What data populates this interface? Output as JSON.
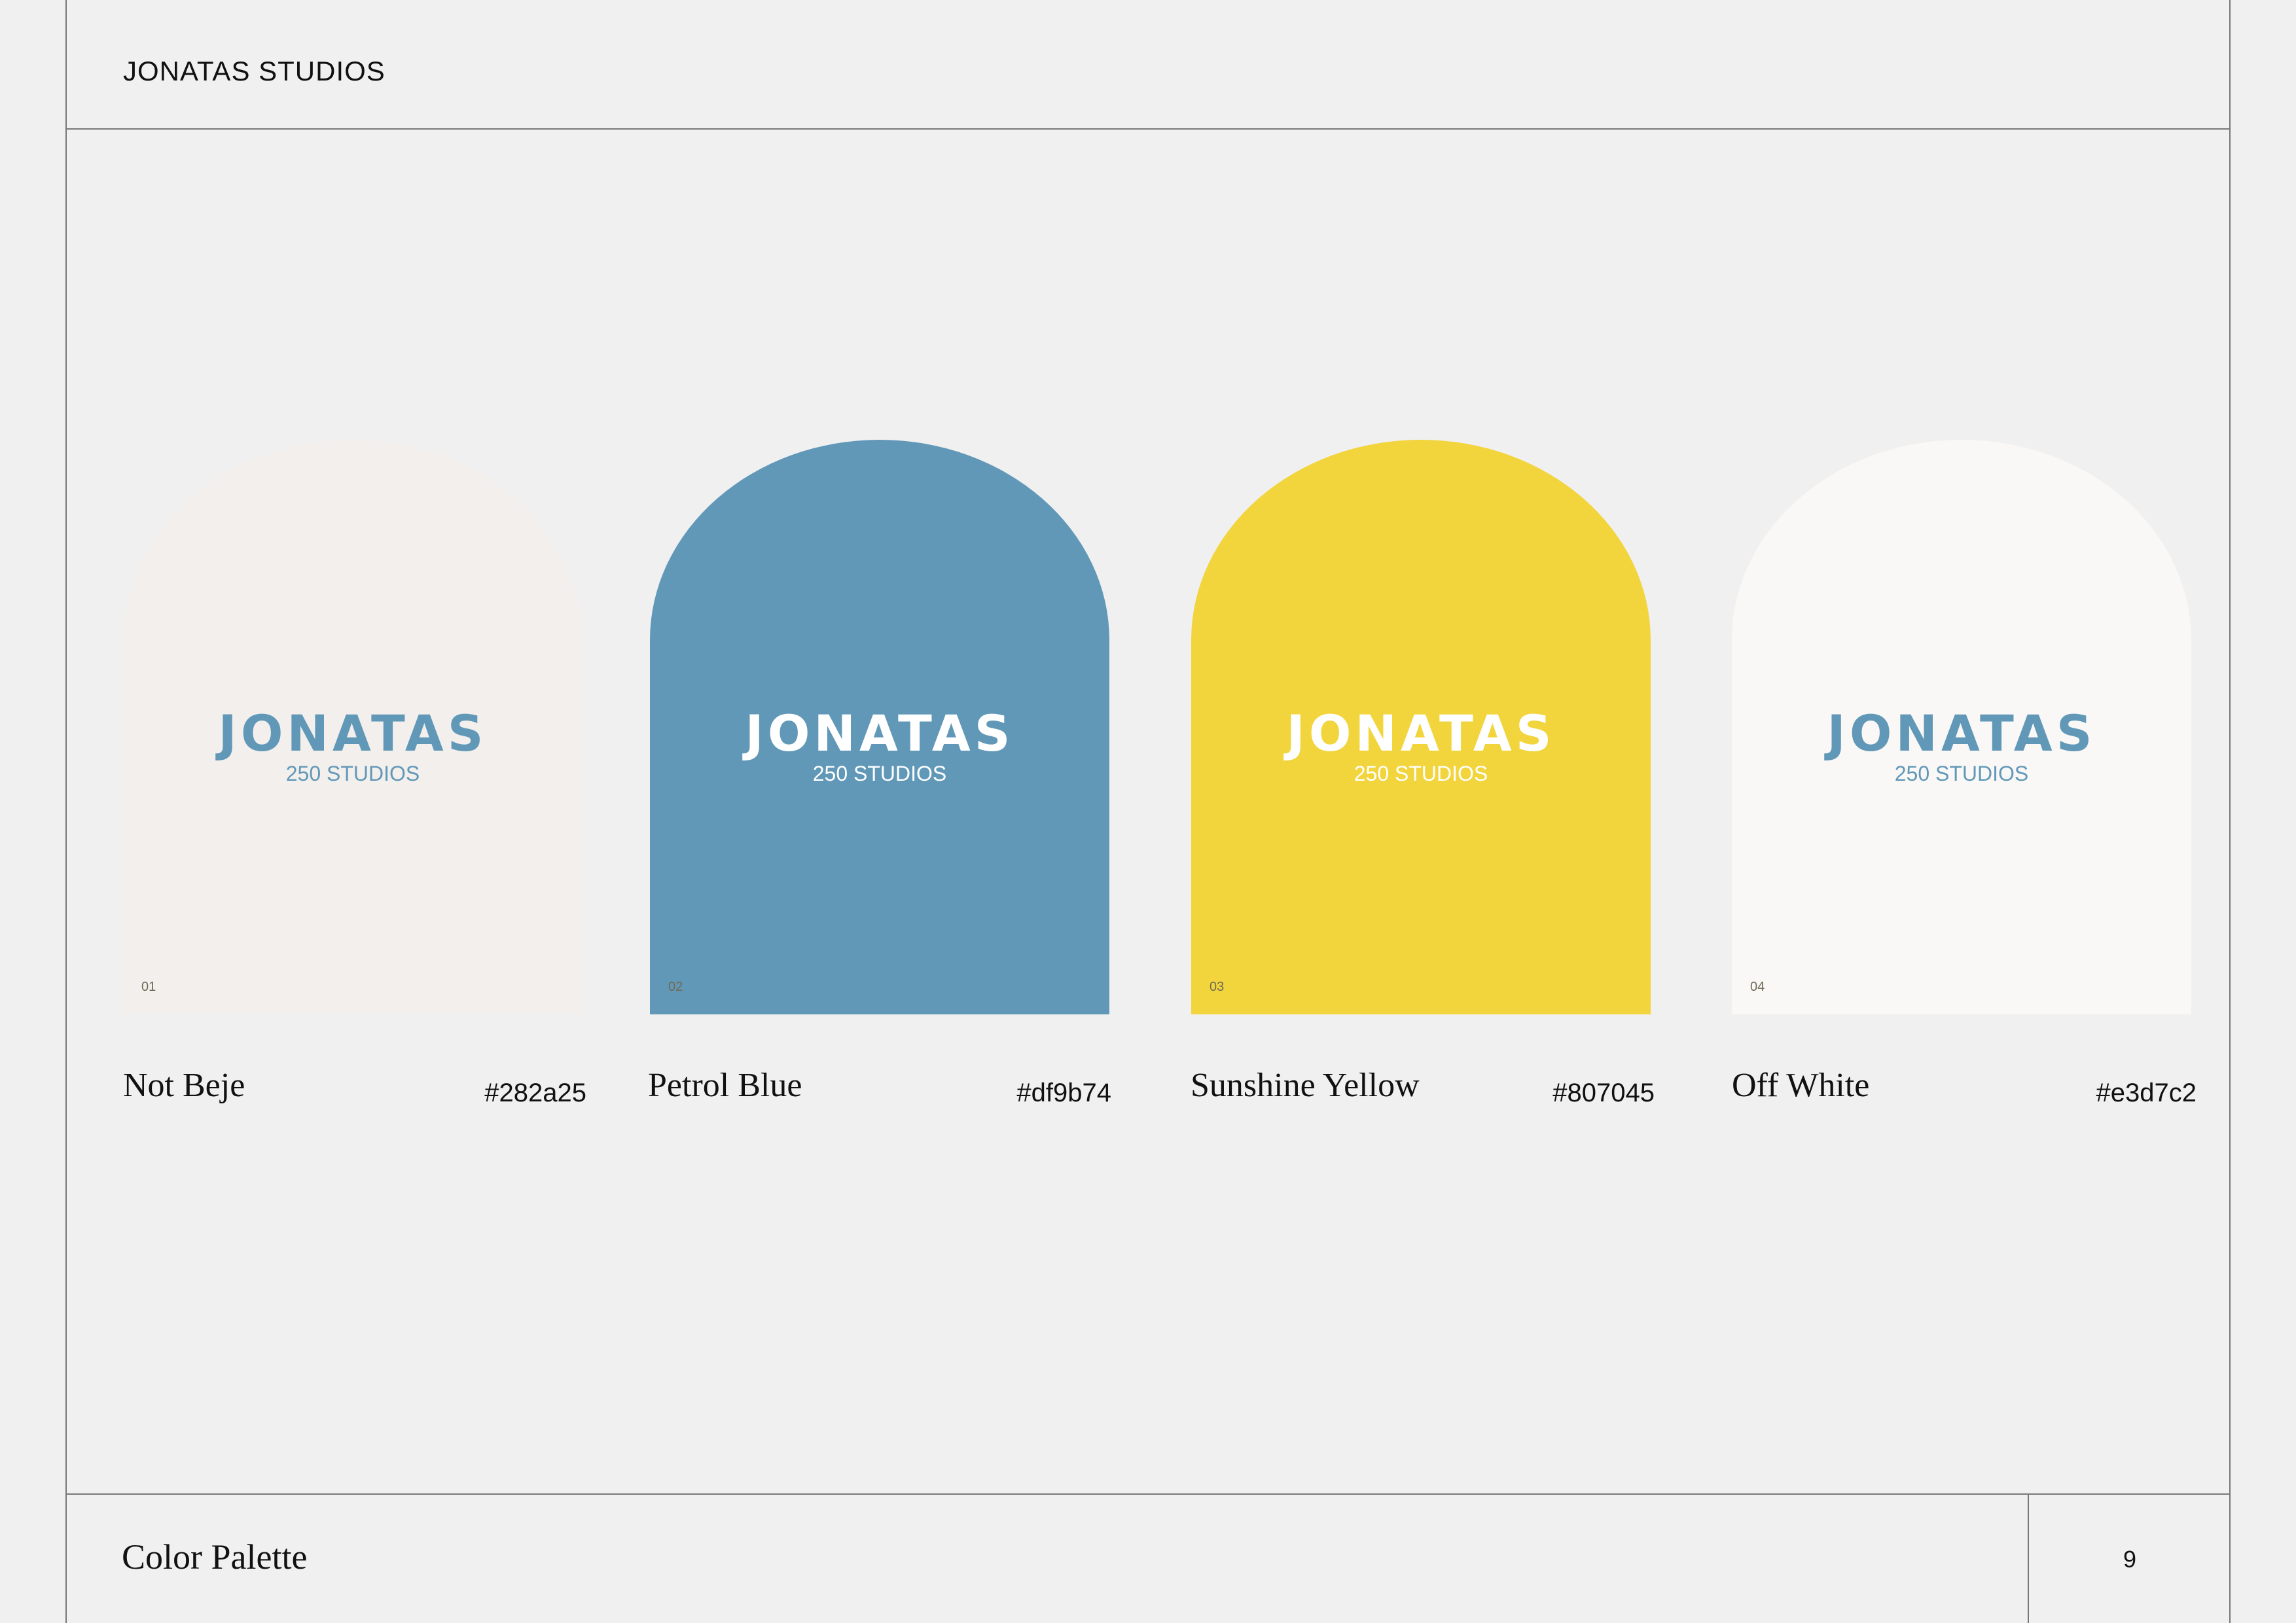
{
  "header": {
    "brand": "JONATAS STUDIOS"
  },
  "palette": [
    {
      "number": "01",
      "name": "Not Beje",
      "hex_label": "#282a25",
      "fill": "#f2efec",
      "logo_word": "JONATAS",
      "logo_sub": "250 STUDIOS",
      "logo_word_color": "#6198b8",
      "logo_sub_color": "#6198b8"
    },
    {
      "number": "02",
      "name": "Petrol Blue",
      "hex_label": "#df9b74",
      "fill": "#6198b8",
      "logo_word": "JONATAS",
      "logo_sub": "250 STUDIOS",
      "logo_word_color": "#ffffff",
      "logo_sub_color": "#ffffff"
    },
    {
      "number": "03",
      "name": "Sunshine Yellow",
      "hex_label": "#807045",
      "fill": "#f2d43c",
      "logo_word": "JONATAS",
      "logo_sub": "250 STUDIOS",
      "logo_word_color": "#ffffff",
      "logo_sub_color": "#ffffff"
    },
    {
      "number": "04",
      "name": "Off White",
      "hex_label": "#e3d7c2",
      "fill": "#f9f8f6",
      "logo_word": "JONATAS",
      "logo_sub": "250 STUDIOS",
      "logo_word_color": "#6198b8",
      "logo_sub_color": "#6198b8"
    }
  ],
  "footer": {
    "title": "Color Palette",
    "page_number": "9"
  }
}
